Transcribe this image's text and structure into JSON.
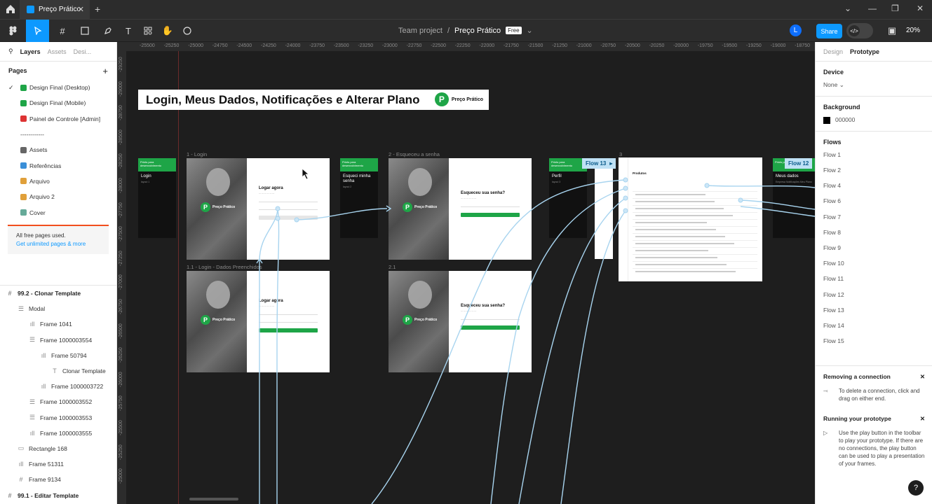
{
  "tabbar": {
    "tab_title": "Preço Prático",
    "close_symbol": "✕",
    "new_tab_symbol": "+",
    "window_controls": [
      "⌄",
      "—",
      "❐",
      "✕"
    ]
  },
  "toolbar": {
    "breadcrumb_team": "Team project",
    "breadcrumb_sep": "/",
    "file_name": "Preço Prático",
    "plan_badge": "Free",
    "avatar_letter": "L",
    "share_label": "Share",
    "zoom": "20%",
    "dev_mode_icon": "</>"
  },
  "left_panel": {
    "tabs": {
      "layers": "Layers",
      "assets": "Assets",
      "design": "Desi..."
    },
    "pages_title": "Pages",
    "add_symbol": "+",
    "pages": [
      {
        "label": "Design Final (Desktop)",
        "icon": "green-check",
        "current": true
      },
      {
        "label": "Design Final (Mobile)",
        "icon": "green-check",
        "current": false
      },
      {
        "label": "Painel de Controle [Admin]",
        "icon": "toolbox",
        "current": false
      },
      {
        "label": "------------",
        "icon": "",
        "current": false
      },
      {
        "label": "Assets",
        "icon": "pencil",
        "current": false
      },
      {
        "label": "Referências",
        "icon": "ship",
        "current": false
      },
      {
        "label": "Arquivo",
        "icon": "folder",
        "current": false
      },
      {
        "label": "Arquivo 2",
        "icon": "folder",
        "current": false
      },
      {
        "label": "Cover",
        "icon": "image",
        "current": false
      }
    ],
    "notice": {
      "text": "All free pages used.",
      "link": "Get unlimited pages & more"
    },
    "layers": [
      {
        "label": "99.2 - Clonar Template",
        "icon": "#",
        "depth": 0,
        "top": true
      },
      {
        "label": "Modal",
        "icon": "☰",
        "depth": 1,
        "top": false
      },
      {
        "label": "Frame 1041",
        "icon": "ıll",
        "depth": 2,
        "top": false
      },
      {
        "label": "Frame 1000003554",
        "icon": "☰",
        "depth": 2,
        "top": false
      },
      {
        "label": "Frame 50794",
        "icon": "ıll",
        "depth": 3,
        "top": false
      },
      {
        "label": "Clonar Template",
        "icon": "T",
        "depth": 4,
        "top": false
      },
      {
        "label": "Frame 1000003722",
        "icon": "ıll",
        "depth": 3,
        "top": false
      },
      {
        "label": "Frame 1000003552",
        "icon": "☰",
        "depth": 2,
        "top": false
      },
      {
        "label": "Frame 1000003553",
        "icon": "☰",
        "depth": 2,
        "top": false
      },
      {
        "label": "Frame 1000003555",
        "icon": "ıll",
        "depth": 2,
        "top": false
      },
      {
        "label": "Rectangle 168",
        "icon": "▭",
        "depth": 1,
        "top": false
      },
      {
        "label": "Frame 51311",
        "icon": "ıll",
        "depth": 1,
        "top": false
      },
      {
        "label": "Frame 9134",
        "icon": "#",
        "depth": 1,
        "top": false
      },
      {
        "label": "99.1 - Editar Template",
        "icon": "#",
        "depth": 0,
        "top": true
      }
    ]
  },
  "right_panel": {
    "tabs": {
      "design": "Design",
      "prototype": "Prototype"
    },
    "device_title": "Device",
    "device_value": "None",
    "background_title": "Background",
    "background_value": "000000",
    "flows_title": "Flows",
    "flows": [
      "Flow 1",
      "Flow 2",
      "Flow 4",
      "Flow 6",
      "Flow 7",
      "Flow 8",
      "Flow 9",
      "Flow 10",
      "Flow 11",
      "Flow 12",
      "Flow 13",
      "Flow 14",
      "Flow 15"
    ],
    "help": [
      {
        "title": "Removing a connection",
        "text": "To delete a connection, click and drag on either end."
      },
      {
        "title": "Running your prototype",
        "text": "Use the play button in the toolbar to play your prototype. If there are no connections, the play button can be used to play a presentation of your frames."
      }
    ],
    "help_button": "?"
  },
  "rulers": {
    "top": [
      "-25500",
      "-25250",
      "-25000",
      "-24750",
      "-24500",
      "-24250",
      "-24000",
      "-23750",
      "-23500",
      "-23250",
      "-23000",
      "-22750",
      "-22500",
      "-22250",
      "-22000",
      "-21750",
      "-21500",
      "-21250",
      "-21000",
      "-20750",
      "-20500",
      "-20250",
      "-20000",
      "-19750",
      "-19500",
      "-19250",
      "-19000",
      "-18750"
    ],
    "left": [
      "-29250",
      "-29000",
      "-28750",
      "-28500",
      "-28250",
      "-28000",
      "-27750",
      "-27500",
      "-27250",
      "-27000",
      "-26750",
      "-26500",
      "-26250",
      "-26000",
      "-25750",
      "-25500",
      "-25250",
      "-25000"
    ]
  },
  "canvas": {
    "banner_title": "Login, Meus Dados, Notificações e Alterar Plano",
    "banner_brand": "Preço Prático",
    "frame_labels": {
      "login": "1 - Login",
      "forgot": "2 - Esqueceu a senha",
      "dash": "3",
      "login_filled": "1.1 - Login - Dados Preenchidos",
      "forgot_alt": "2.1"
    },
    "side_cards": {
      "header": "Prints para desenvolvimento",
      "login": "Login",
      "login_sub": "layout 1",
      "forgot": "Esqueci minha senha",
      "forgot_sub": "layout 2",
      "perfil": "Perfil",
      "perfil_sub": "layout 3",
      "meus_dados": "Meus dados",
      "meus_dados_sub": "Empresa Notificações Meu Plano"
    },
    "screens": {
      "brand": "Preço Prático",
      "login_heading": "Logar agora",
      "forgot_heading": "Esqueceu sua senha?"
    },
    "dashboard_title": "Produtos",
    "flow_tags": [
      "Flow 13",
      "Flow 12"
    ]
  }
}
